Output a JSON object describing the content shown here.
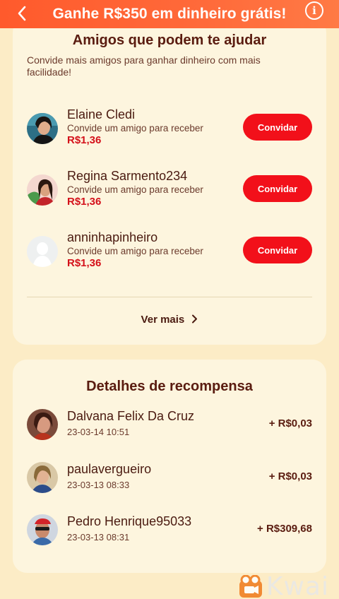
{
  "header": {
    "title": "Ganhe R$350 em dinheiro grátis!",
    "back_icon": "chevron-left-icon",
    "info_icon": "info-icon",
    "info_glyph": "i"
  },
  "friends_card": {
    "title": "Amigos que podem te ajudar",
    "subtitle": "Convide mais amigos para ganhar dinheiro com mais facilidade!",
    "invite_label": "Convidar",
    "friends": [
      {
        "name": "Elaine Cledi",
        "desc": "Convide um amigo para receber",
        "amount": "R$1,36"
      },
      {
        "name": "Regina Sarmento234",
        "desc": "Convide um amigo para receber",
        "amount": "R$1,36"
      },
      {
        "name": "anninhapinheiro",
        "desc": "Convide um amigo para receber",
        "amount": "R$1,36"
      }
    ],
    "see_more": "Ver mais"
  },
  "rewards_card": {
    "title": "Detalhes de recompensa",
    "rewards": [
      {
        "name": "Dalvana Felix Da Cruz",
        "date": "23-03-14 10:51",
        "value": "+ R$0,03"
      },
      {
        "name": "paulavergueiro",
        "date": "23-03-13 08:33",
        "value": "+ R$0,03"
      },
      {
        "name": "Pedro Henrique95033",
        "date": "23-03-13 08:31",
        "value": "+ R$309,68"
      }
    ]
  },
  "watermark": {
    "text": "Kwai"
  },
  "colors": {
    "header": "#ff5a2c",
    "background": "#fcecc6",
    "card": "#fdf5de",
    "button": "#f2101a",
    "amount": "#d4101a",
    "title": "#5a1c10"
  }
}
